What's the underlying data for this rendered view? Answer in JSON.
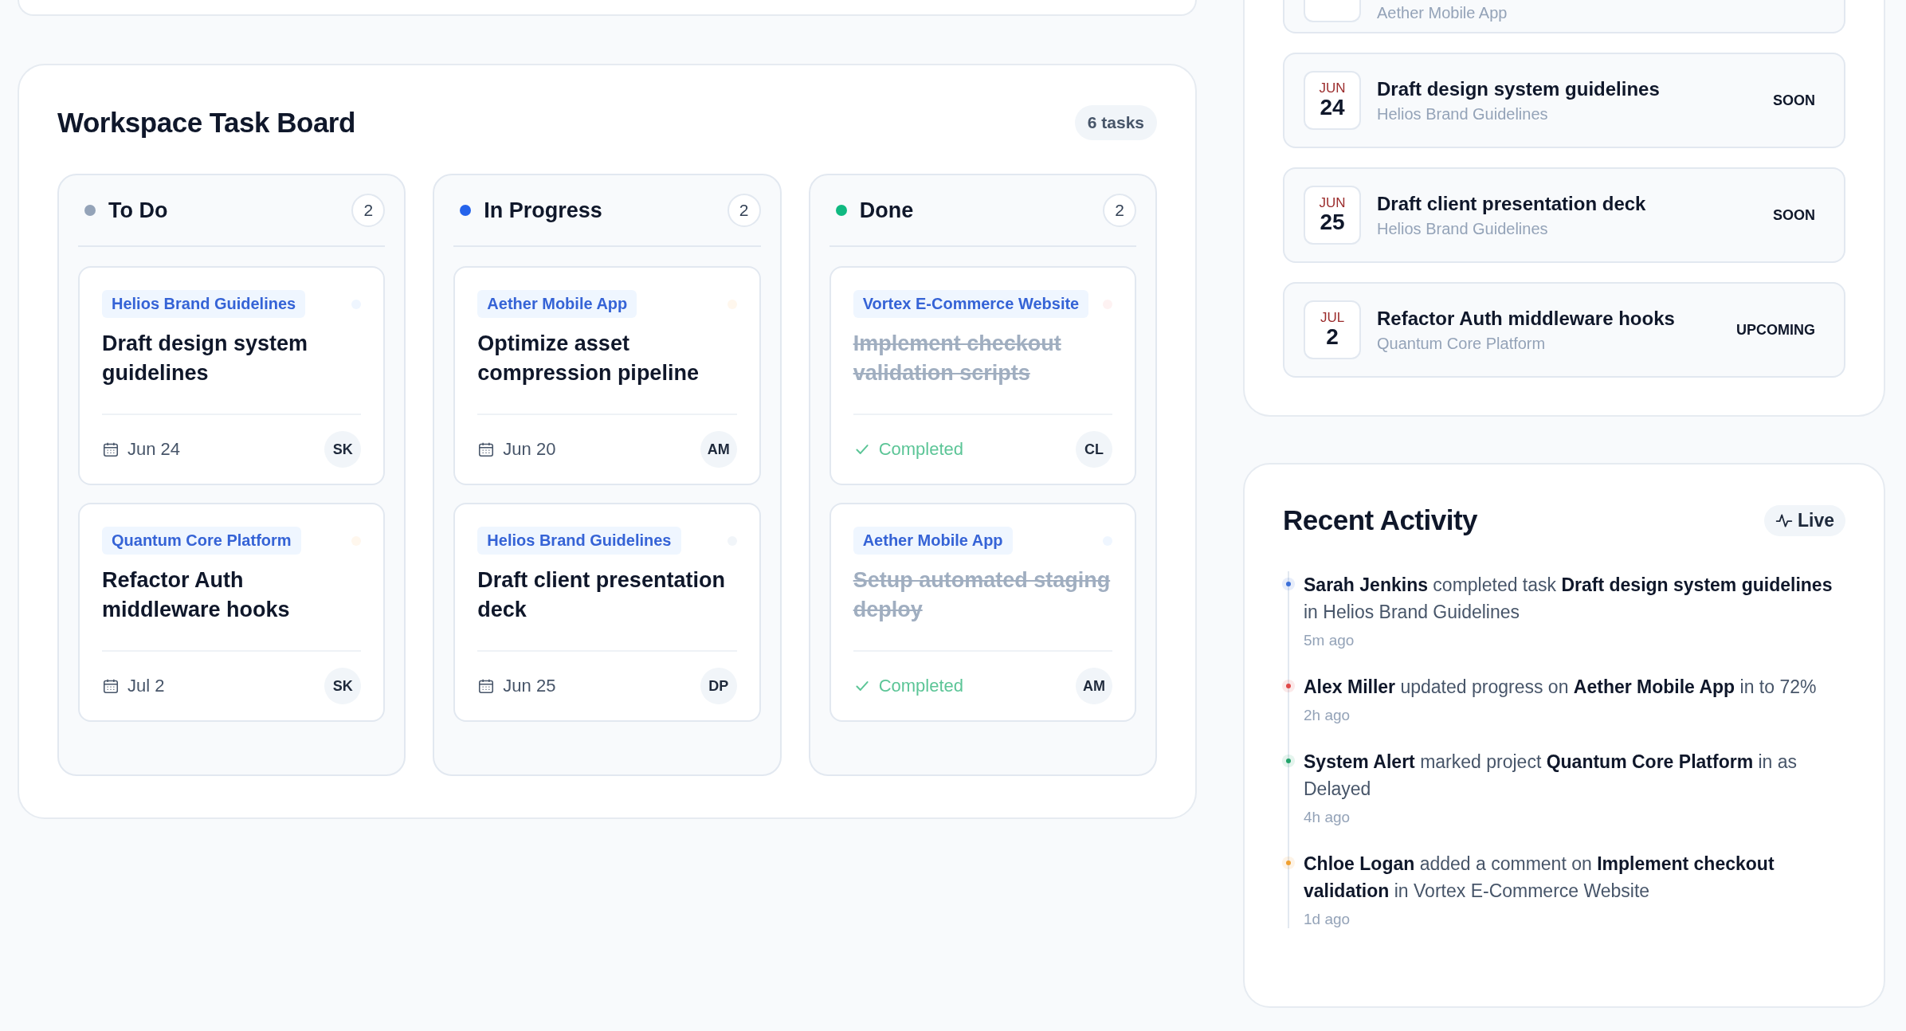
{
  "task_board": {
    "title": "Workspace Task Board",
    "count": "6 tasks",
    "columns": [
      {
        "title": "To Do",
        "count": "2",
        "color": "#94a3b8",
        "cards": [
          {
            "project": "Helios Brand Guidelines",
            "title": "Draft design system guidelines",
            "done": false,
            "date": "Jun 24",
            "assignee": "SK",
            "color": "#eff6ff"
          },
          {
            "project": "Quantum Core Platform",
            "title": "Refactor Auth middleware hooks",
            "done": false,
            "date": "Jul 2",
            "assignee": "SK",
            "color": "#fff7ed"
          }
        ]
      },
      {
        "title": "In Progress",
        "count": "2",
        "color": "#2563eb",
        "cards": [
          {
            "project": "Aether Mobile App",
            "title": "Optimize asset compression pipeline",
            "done": false,
            "date": "Jun 20",
            "assignee": "AM",
            "color": "#fff7ed"
          },
          {
            "project": "Helios Brand Guidelines",
            "title": "Draft client presentation deck",
            "done": false,
            "date": "Jun 25",
            "assignee": "DP",
            "color": "#f1f5f9"
          }
        ]
      },
      {
        "title": "Done",
        "count": "2",
        "color": "#10b981",
        "cards": [
          {
            "project": "Vortex E-Commerce Website",
            "title": "Implement checkout validation scripts",
            "done": true,
            "status": "Completed",
            "assignee": "CL",
            "color": "#fef2f2"
          },
          {
            "project": "Aether Mobile App",
            "title": "Setup automated staging deploy",
            "done": true,
            "status": "Completed",
            "assignee": "AM",
            "color": "#eff6ff"
          }
        ]
      }
    ]
  },
  "upcoming": {
    "partial_item": {
      "project": "Aether Mobile App"
    },
    "items": [
      {
        "month": "JUN",
        "day": "24",
        "title": "Draft design system guidelines",
        "project": "Helios Brand Guidelines",
        "badge": "SOON"
      },
      {
        "month": "JUN",
        "day": "25",
        "title": "Draft client presentation deck",
        "project": "Helios Brand Guidelines",
        "badge": "SOON"
      },
      {
        "month": "JUL",
        "day": "2",
        "title": "Refactor Auth middleware hooks",
        "project": "Quantum Core Platform",
        "badge": "UPCOMING"
      }
    ]
  },
  "activity": {
    "title": "Recent Activity",
    "live": "Live",
    "items": [
      {
        "text": "**Sarah Jenkins** completed task **Draft design system guidelines** in Helios Brand Guidelines",
        "time": "5m ago",
        "color": "#3b6fd8"
      },
      {
        "text": "**Alex Miller** updated progress on **Aether Mobile App** in to 72%",
        "time": "2h ago",
        "color": "#e04848"
      },
      {
        "text": "**System Alert** marked project **Quantum Core Platform** in as Delayed",
        "time": "4h ago",
        "color": "#22a36a"
      },
      {
        "text": "**Chloe Logan** added a comment on **Implement checkout validation** in Vortex E-Commerce Website",
        "time": "1d ago",
        "color": "#f0a030"
      }
    ]
  }
}
